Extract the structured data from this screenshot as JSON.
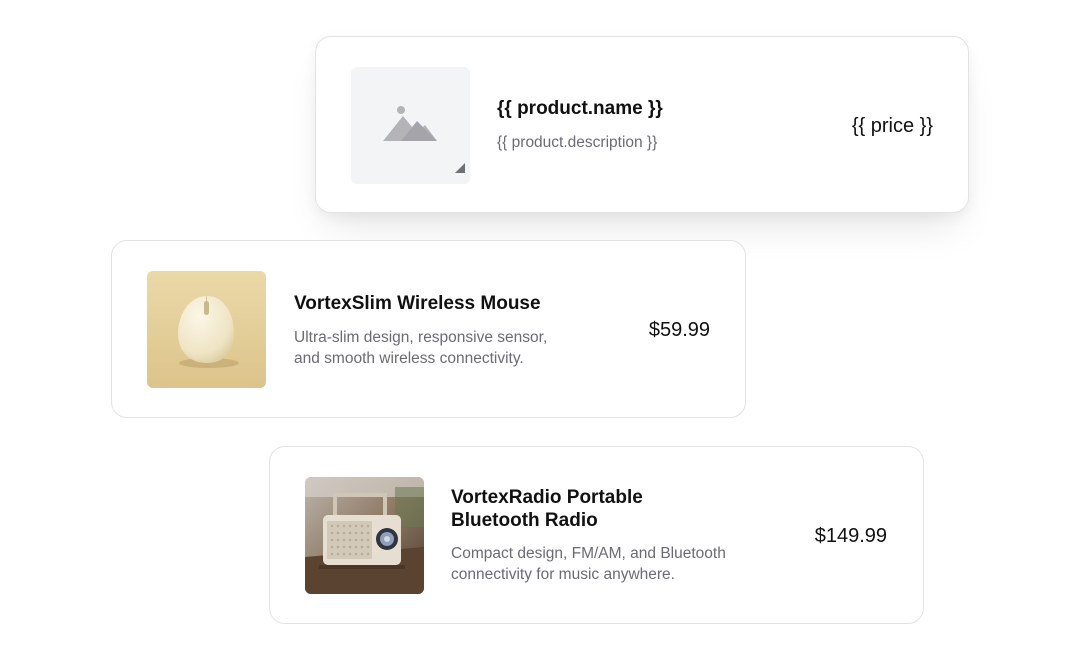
{
  "template_card": {
    "title": "{{ product.name }}",
    "description": "{{ product.description }}",
    "price": "{{ price }}",
    "image_icon": "image-placeholder-icon"
  },
  "products": [
    {
      "title": "VortexSlim Wireless Mouse",
      "description_lines": [
        "Ultra-slim design, responsive sensor,",
        "and smooth wireless connectivity."
      ],
      "price": "$59.99",
      "image": "wireless-mouse-photo"
    },
    {
      "title_lines": [
        "VortexRadio Portable",
        "Bluetooth Radio"
      ],
      "description_lines": [
        "Compact design, FM/AM, and Bluetooth",
        "connectivity for music anywhere."
      ],
      "price": "$149.99",
      "image": "portable-radio-photo"
    }
  ],
  "colors": {
    "card_border": "#e3e3e6",
    "title": "#111111",
    "description": "#6b6b72",
    "placeholder_bg": "#f3f4f6",
    "placeholder_icon": "#b3b3b8",
    "mouse_bg": "#e6d4a0",
    "radio_bg": "#6f5a48"
  }
}
